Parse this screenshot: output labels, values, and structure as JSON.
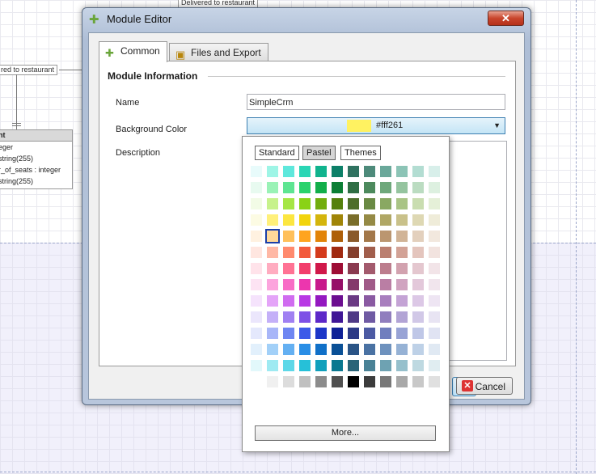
{
  "background": {
    "top_label": "Delivered to restaurant",
    "left_label": "red to restaurant",
    "entity": {
      "header": "nt",
      "rows": [
        "eger",
        "  string(255)",
        "r_of_seats : integer",
        "  string(255)"
      ]
    }
  },
  "dialog": {
    "title": "Module Editor",
    "close_label": "✕",
    "tabs": [
      {
        "label": "Common",
        "icon": "puzzle-icon"
      },
      {
        "label": "Files and Export",
        "icon": "box-icon"
      }
    ],
    "section_title": "Module Information",
    "fields": {
      "name_label": "Name",
      "name_value": "SimpleCrm",
      "bg_color_label": "Background Color",
      "bg_color_value": "#fff261",
      "description_label": "Description"
    },
    "cancel_label": "Cancel"
  },
  "color_popup": {
    "tabs": [
      "Standard",
      "Pastel",
      "Themes"
    ],
    "active_tab": "Pastel",
    "more_label": "More...",
    "selected": {
      "row": 4,
      "col": 1
    },
    "grid": [
      [
        "#e8fbfb",
        "#9ef5e6",
        "#5ee8dc",
        "#2ad6b5",
        "#10b38d",
        "#0c8068",
        "#2f7260",
        "#4d8a7a",
        "#6aa89a",
        "#8cc4b6",
        "#b3ddd2",
        "#d8efea"
      ],
      [
        "#e8faf0",
        "#9af2b6",
        "#5ee592",
        "#2ad26c",
        "#12ae4a",
        "#0c7f35",
        "#2f6e44",
        "#4d8a5d",
        "#6ea87b",
        "#95c49f",
        "#bbdcc1",
        "#ddf0e0"
      ],
      [
        "#f2fbe6",
        "#c7f28c",
        "#a5e645",
        "#8ad215",
        "#72ad0c",
        "#55800c",
        "#4d6e2a",
        "#6a8a44",
        "#89a862",
        "#a9c485",
        "#c9ddb0",
        "#e5f0d8"
      ],
      [
        "#fcfbe3",
        "#fff07a",
        "#fce640",
        "#f2d40c",
        "#d4b50c",
        "#a08508",
        "#7a6e2a",
        "#958a45",
        "#b0a765",
        "#c9c18a",
        "#ded8b3",
        "#efecd9"
      ],
      [
        "#fff1e0",
        "#ffd99a",
        "#ffc05a",
        "#ffa41f",
        "#e28408",
        "#ae5f08",
        "#8a5a2a",
        "#a3784a",
        "#bb9670",
        "#d1b497",
        "#e3d0bd",
        "#f2e8de"
      ],
      [
        "#ffe6e0",
        "#ffb8a5",
        "#ff8a6e",
        "#f25a3c",
        "#d43b1c",
        "#a02a10",
        "#85402e",
        "#a15e4c",
        "#bb7f70",
        "#d2a296",
        "#e4c5bd",
        "#f2e3df"
      ],
      [
        "#ffe3ea",
        "#ffacc0",
        "#ff7294",
        "#f23e6c",
        "#d0184a",
        "#9e0d35",
        "#8a3a50",
        "#a35a6d",
        "#bc7d8d",
        "#d2a2af",
        "#e4c7cf",
        "#f2e4e8"
      ],
      [
        "#fde3f3",
        "#fca4dd",
        "#f86cc6",
        "#ec36ae",
        "#c8198c",
        "#960f68",
        "#843a6c",
        "#a05a88",
        "#ba7ea4",
        "#d0a3c0",
        "#e3c8da",
        "#f1e5ed"
      ],
      [
        "#f5e3fc",
        "#e4a4f8",
        "#d06cf0",
        "#b838e4",
        "#9418c0",
        "#6c0e90",
        "#6b3a84",
        "#8a5aa2",
        "#a87ebe",
        "#c4a3d5",
        "#dcc8e6",
        "#eee5f3"
      ],
      [
        "#ebe6fc",
        "#c4b0f8",
        "#a080f2",
        "#7d50e6",
        "#5c28c8",
        "#3f1696",
        "#4f3a86",
        "#6f5aa3",
        "#907ebe",
        "#b2a4d5",
        "#d1c8e7",
        "#e8e4f3"
      ],
      [
        "#e4e8fc",
        "#a8b6f8",
        "#6e86f2",
        "#3c5ae8",
        "#1c36c8",
        "#0e2096",
        "#2c3a86",
        "#4c5aa3",
        "#707ebe",
        "#98a3d5",
        "#bfc7e7",
        "#e0e3f3"
      ],
      [
        "#e2f0fc",
        "#a2d0f8",
        "#64b0f2",
        "#2a8ee6",
        "#1070c8",
        "#0a5096",
        "#2a5486",
        "#4a72a3",
        "#6e92be",
        "#96b2d5",
        "#bed1e7",
        "#e0e9f3"
      ],
      [
        "#e2f8fb",
        "#9eeaf2",
        "#5ed8e8",
        "#26c0d8",
        "#10a0bc",
        "#0a7890",
        "#2a6478",
        "#4a8296",
        "#6ea2b2",
        "#96c0cc",
        "#bed9e1",
        "#e0edf1"
      ],
      [
        "#ffffff",
        "#f0f0f0",
        "#dcdcdc",
        "#c0c0c0",
        "#8c8c8c",
        "#505050",
        "#000000",
        "#3c3c3c",
        "#787878",
        "#a8a8a8",
        "#c8c8c8",
        "#e0e0e0"
      ]
    ]
  }
}
